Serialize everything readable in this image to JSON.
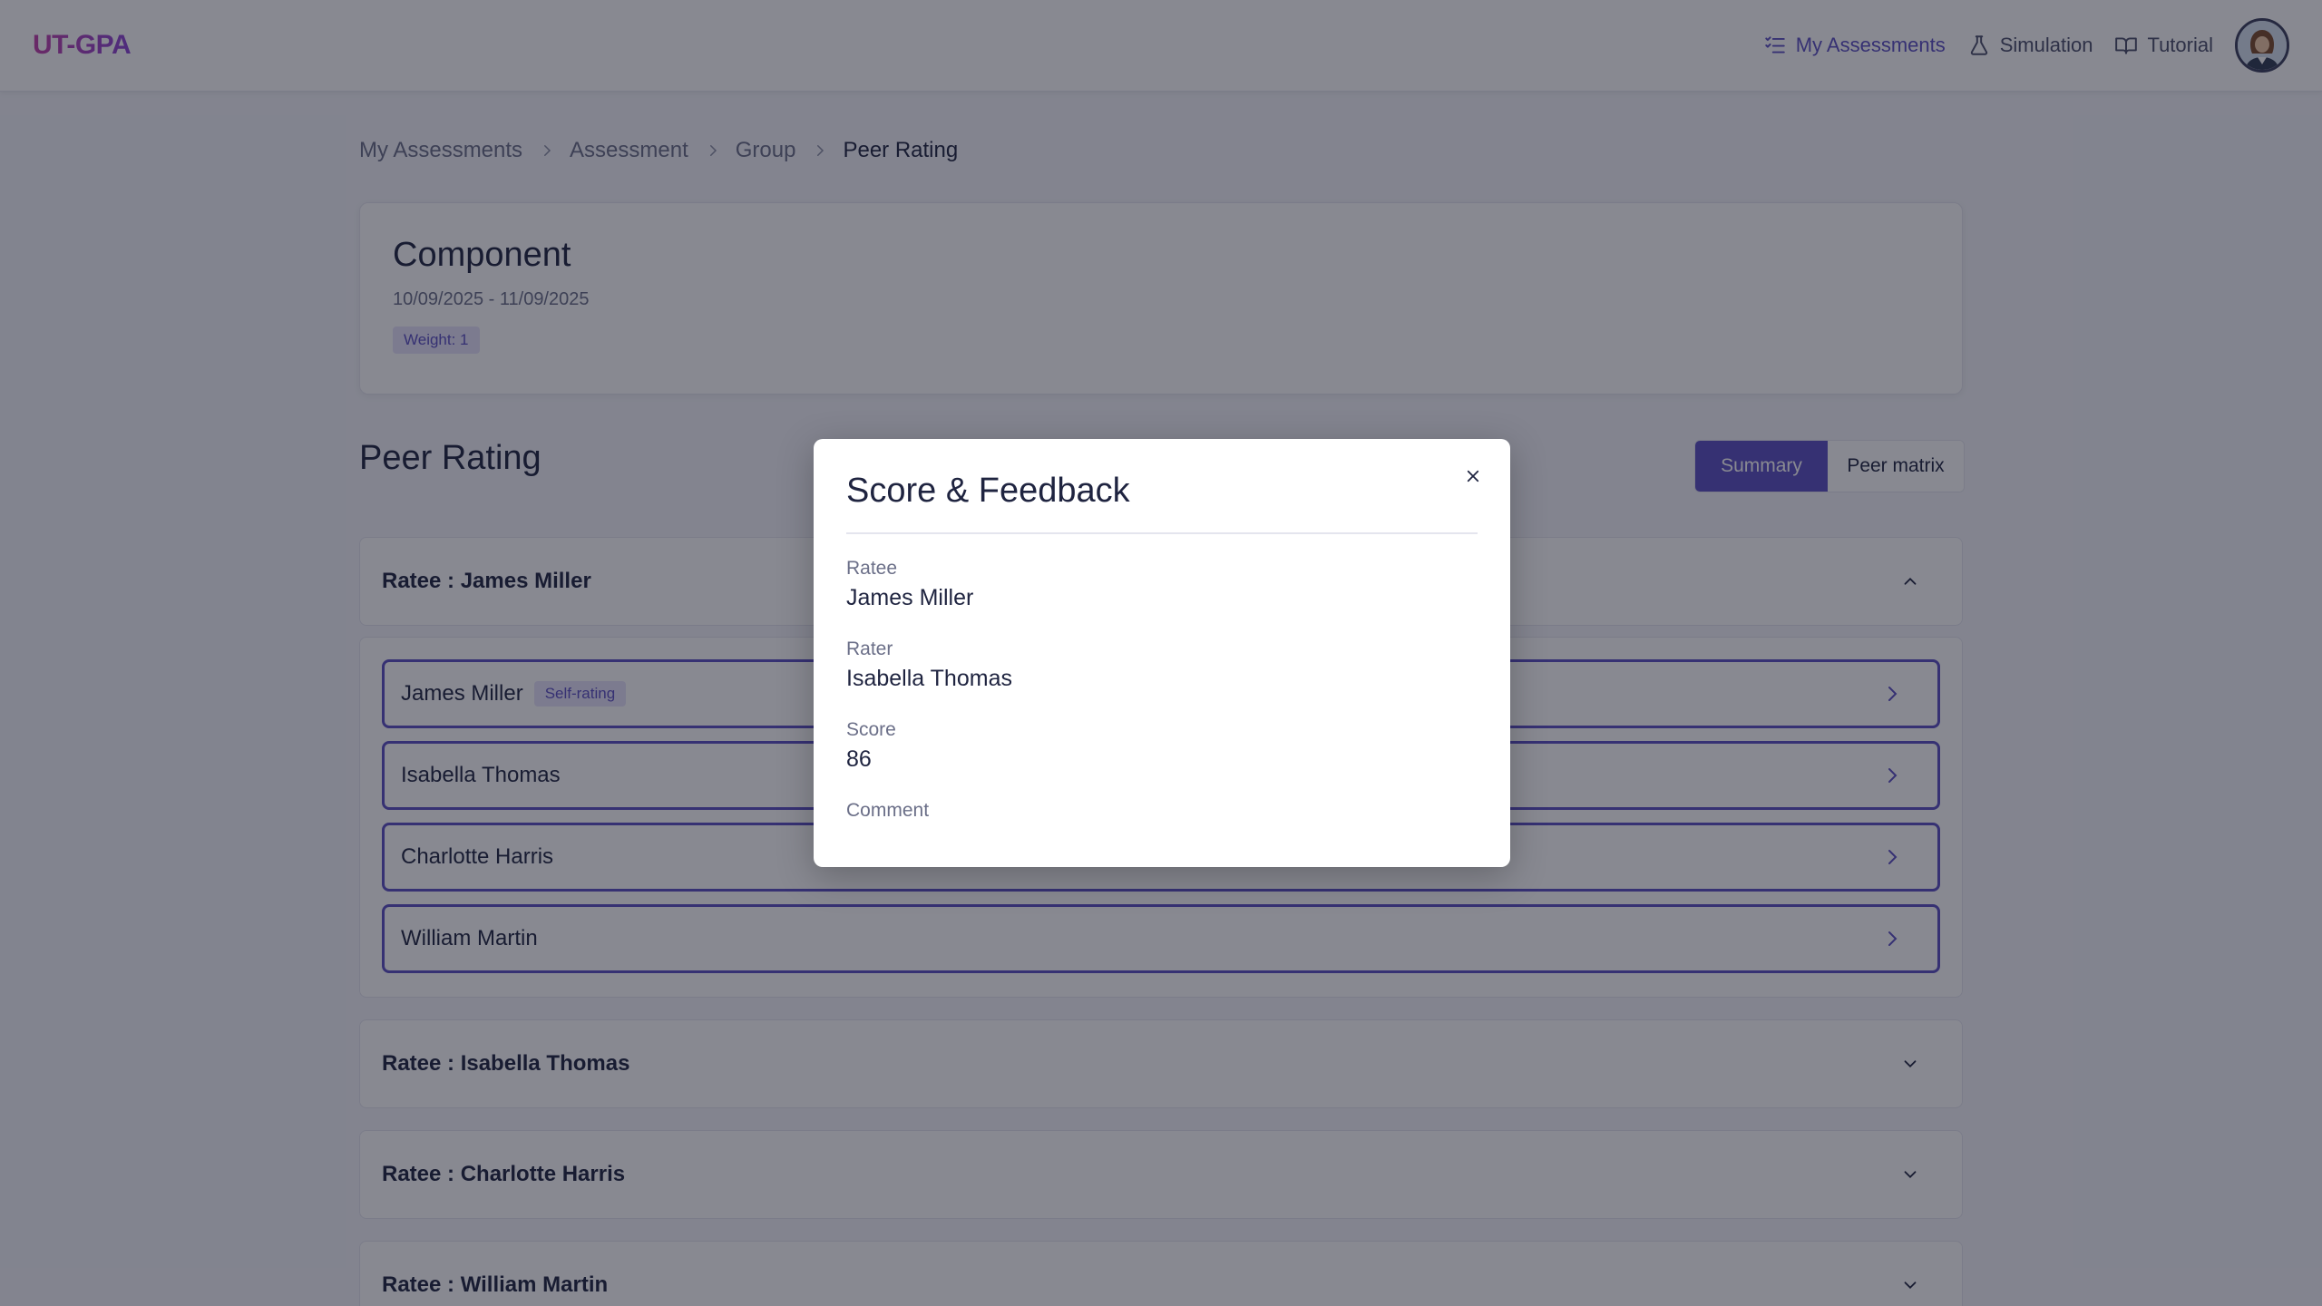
{
  "header": {
    "logo": "UT-GPA",
    "nav": [
      {
        "label": "My Assessments",
        "icon": "list-check-icon",
        "active": true
      },
      {
        "label": "Simulation",
        "icon": "flask-icon",
        "active": false
      },
      {
        "label": "Tutorial",
        "icon": "book-icon",
        "active": false
      }
    ],
    "avatar_icon": "user-avatar"
  },
  "breadcrumb": [
    "My Assessments",
    "Assessment",
    "Group",
    "Peer Rating"
  ],
  "component": {
    "title": "Component",
    "dates": "10/09/2025 - 11/09/2025",
    "weight": "Weight: 1"
  },
  "peer_rating": {
    "title": "Peer Rating",
    "toggle": {
      "summary": "Summary",
      "matrix": "Peer matrix"
    },
    "ratees": [
      {
        "label": "Ratee : James Miller",
        "expanded": true
      },
      {
        "label": "Ratee : Isabella Thomas",
        "expanded": false
      },
      {
        "label": "Ratee : Charlotte Harris",
        "expanded": false
      },
      {
        "label": "Ratee : William Martin",
        "expanded": false
      }
    ],
    "raters": [
      {
        "name": "James Miller",
        "badge": "Self-rating"
      },
      {
        "name": "Isabella Thomas"
      },
      {
        "name": "Charlotte Harris"
      },
      {
        "name": "William Martin"
      }
    ]
  },
  "modal": {
    "title": "Score & Feedback",
    "ratee_label": "Ratee",
    "ratee_value": "James Miller",
    "rater_label": "Rater",
    "rater_value": "Isabella Thomas",
    "score_label": "Score",
    "score_value": "86",
    "comment_label": "Comment"
  },
  "colors": {
    "accent": "#5b4ec2",
    "badge_bg": "#e6e2fa",
    "overlay": "rgba(17,19,36,0.5)"
  }
}
